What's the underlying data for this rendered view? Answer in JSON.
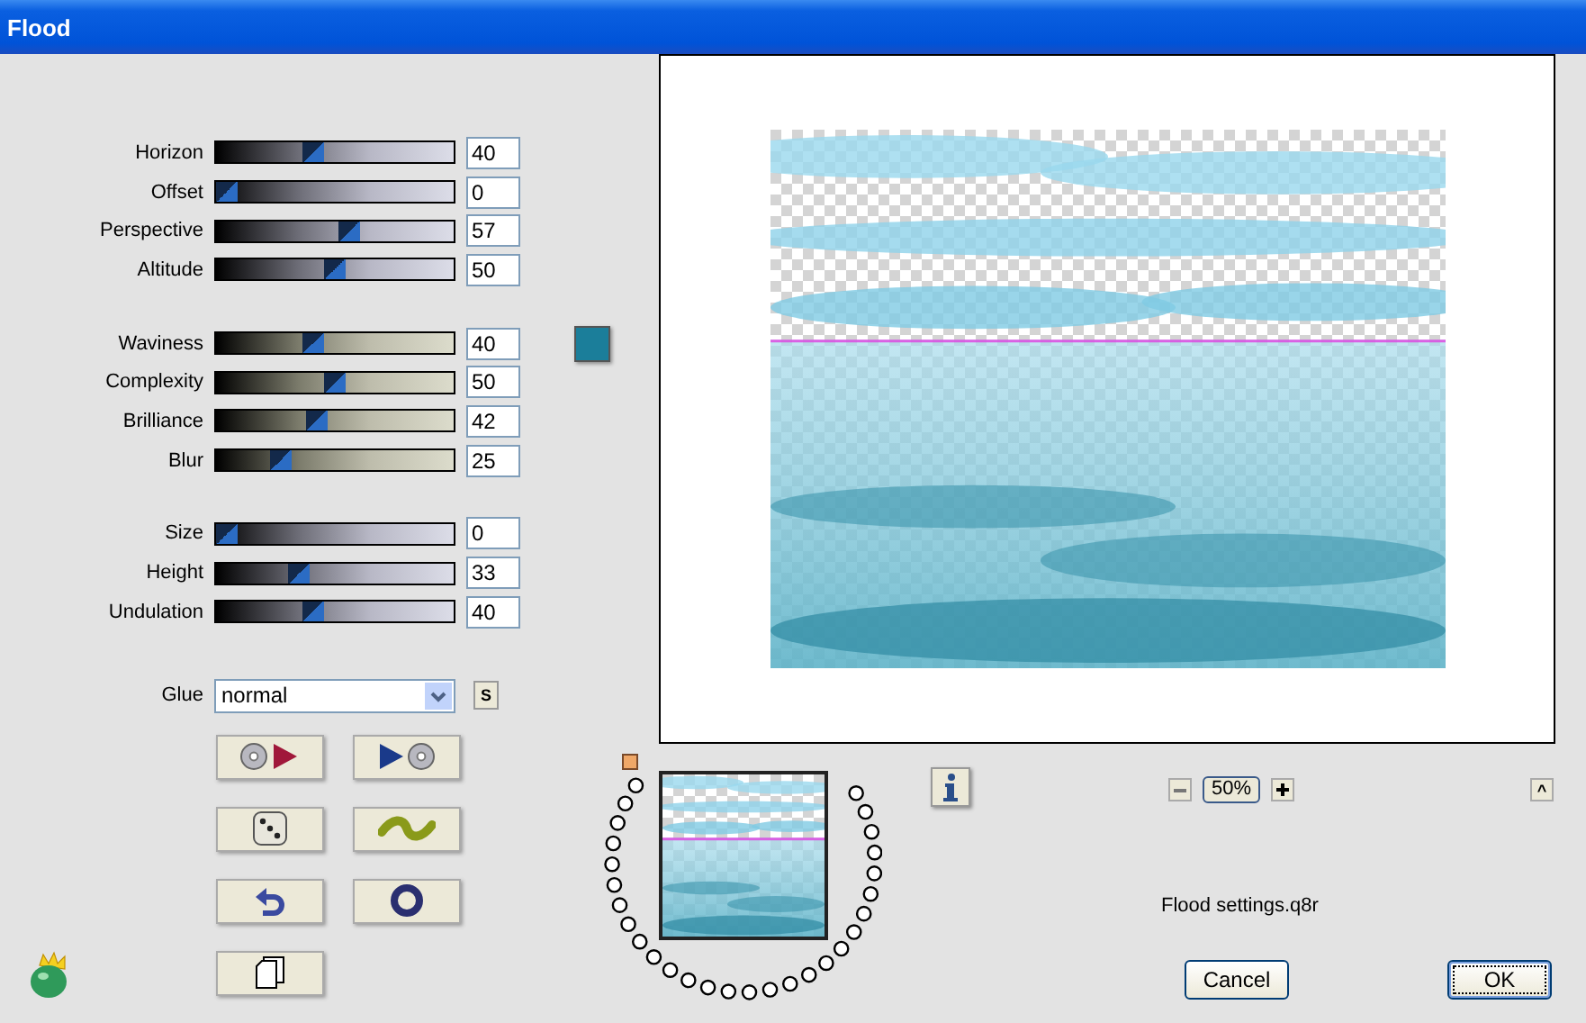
{
  "window": {
    "title": "Flood"
  },
  "slider_groups": [
    {
      "kind": "cool",
      "sliders": [
        {
          "label": "Horizon",
          "value": "40",
          "level": 0.4
        },
        {
          "label": "Offset",
          "value": "0",
          "level": 0
        },
        {
          "label": "Perspective",
          "value": "57",
          "level": 0.57
        },
        {
          "label": "Altitude",
          "value": "50",
          "level": 0.5
        }
      ]
    },
    {
      "kind": "warm",
      "swatch": {
        "color": "#1b7e9a"
      },
      "sliders": [
        {
          "label": "Waviness",
          "value": "40",
          "level": 0.4
        },
        {
          "label": "Complexity",
          "value": "50",
          "level": 0.5
        },
        {
          "label": "Brilliance",
          "value": "42",
          "level": 0.42
        },
        {
          "label": "Blur",
          "value": "25",
          "level": 0.25
        }
      ]
    },
    {
      "kind": "cool",
      "sliders": [
        {
          "label": "Size",
          "value": "0",
          "level": 0
        },
        {
          "label": "Height",
          "value": "33",
          "level": 0.33
        },
        {
          "label": "Undulation",
          "value": "40",
          "level": 0.4
        }
      ]
    }
  ],
  "glue": {
    "label": "Glue",
    "value": "normal",
    "button": "S"
  },
  "tool_buttons": [
    {
      "kind": "load"
    },
    {
      "kind": "save"
    },
    {
      "kind": "random"
    },
    {
      "kind": "wave"
    },
    {
      "kind": "reset"
    },
    {
      "kind": "ring"
    },
    {
      "kind": "copy"
    }
  ],
  "zoom": {
    "value": "50%"
  },
  "collapse_button": "^",
  "file_name": "Flood settings.q8r",
  "buttons": [
    {
      "label": "Cancel",
      "focused": false
    },
    {
      "label": "OK",
      "focused": true
    }
  ]
}
